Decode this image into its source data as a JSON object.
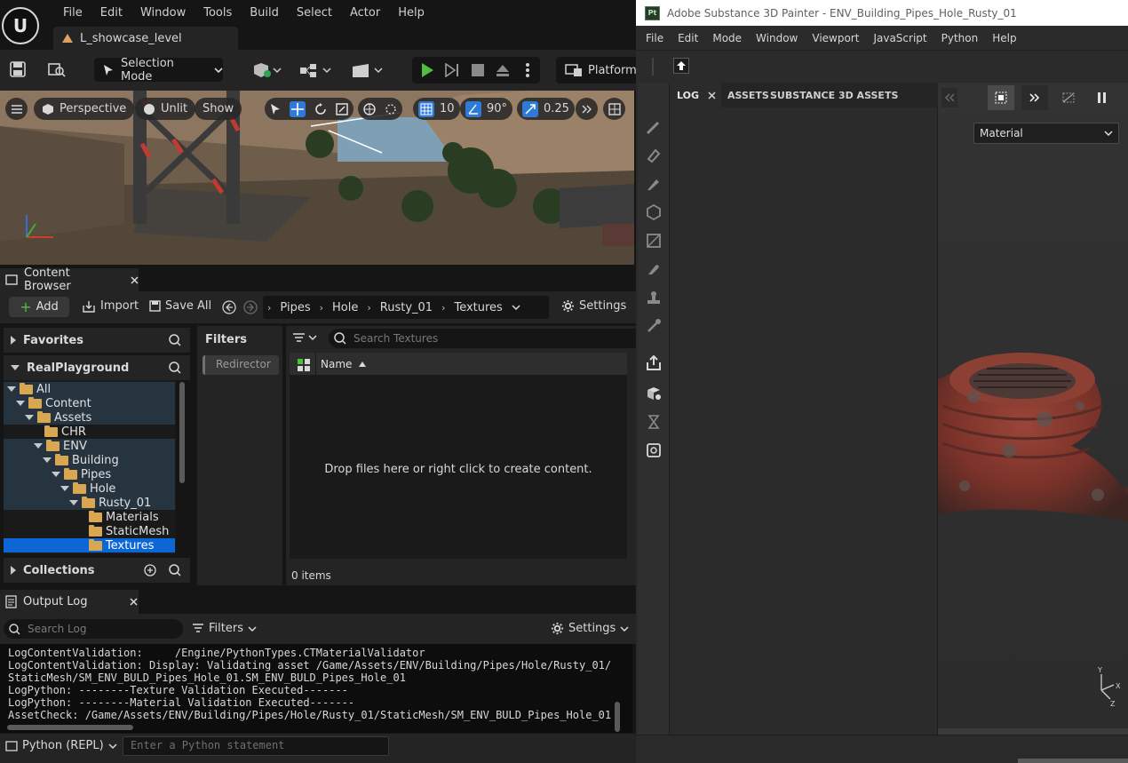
{
  "unreal": {
    "menu": [
      "File",
      "Edit",
      "Window",
      "Tools",
      "Build",
      "Select",
      "Actor",
      "Help"
    ],
    "level_tab": "L_showcase_level",
    "toolbar": {
      "selection_mode": "Selection Mode",
      "platforms": "Platforms"
    },
    "viewport": {
      "perspective": "Perspective",
      "unlit": "Unlit",
      "show": "Show",
      "grid_snap": "10",
      "rotation_snap": "90°",
      "scale_snap": "0.25"
    },
    "content_browser": {
      "tab": "Content Browser",
      "add": "Add",
      "import": "Import",
      "save_all": "Save All",
      "settings": "Settings",
      "breadcrumbs": [
        "Pipes",
        "Hole",
        "Rusty_01",
        "Textures"
      ],
      "favorites": "Favorites",
      "root": "RealPlayground",
      "tree": [
        {
          "label": "All"
        },
        {
          "label": "Content"
        },
        {
          "label": "Assets"
        },
        {
          "label": "CHR"
        },
        {
          "label": "ENV"
        },
        {
          "label": "Building"
        },
        {
          "label": "Pipes"
        },
        {
          "label": "Hole"
        },
        {
          "label": "Rusty_01"
        },
        {
          "label": "Materials"
        },
        {
          "label": "StaticMesh"
        },
        {
          "label": "Textures"
        }
      ],
      "collections": "Collections",
      "filters_title": "Filters",
      "filter_chip": "Redirector",
      "search_placeholder": "Search Textures",
      "column_name": "Name",
      "empty_msg": "Drop files here or right click to create content.",
      "item_count": "0 items"
    },
    "output_log": {
      "tab": "Output Log",
      "search_placeholder": "Search Log",
      "filters": "Filters",
      "settings": "Settings",
      "lines": [
        "LogContentValidation:     /Engine/PythonTypes.CTMaterialValidator",
        "LogContentValidation: Display: Validating asset /Game/Assets/ENV/Building/Pipes/Hole/Rusty_01/",
        "StaticMesh/SM_ENV_BULD_Pipes_Hole_01.SM_ENV_BULD_Pipes_Hole_01",
        "LogPython: --------Texture Validation Executed-------",
        "LogPython: --------Material Validation Executed-------",
        "AssetCheck: /Game/Assets/ENV/Building/Pipes/Hole/Rusty_01/StaticMesh/SM_ENV_BULD_Pipes_Hole_01"
      ],
      "cmd_mode": "Python (REPL)",
      "cmd_placeholder": "Enter a Python statement"
    }
  },
  "substance": {
    "logo": "Pt",
    "title": "Adobe Substance 3D Painter - ENV_Building_Pipes_Hole_Rusty_01",
    "menu": [
      "File",
      "Edit",
      "Mode",
      "Window",
      "Viewport",
      "JavaScript",
      "Python",
      "Help"
    ],
    "tabs": {
      "log": "LOG",
      "assets": "ASSETS",
      "s3d_assets": "SUBSTANCE 3D ASSETS"
    },
    "material_select": "Material",
    "colors": {
      "rust": "#8a3a2e",
      "accent": "#3d8ee6"
    }
  }
}
